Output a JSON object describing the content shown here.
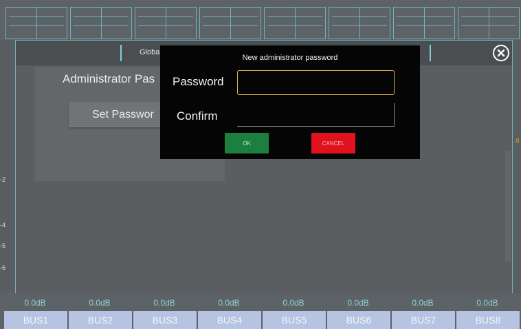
{
  "bus_strip": {
    "levels": [
      "0.0dB",
      "0.0dB",
      "0.0dB",
      "0.0dB",
      "0.0dB",
      "0.0dB",
      "0.0dB",
      "0.0dB"
    ],
    "buses": [
      "BUS1",
      "BUS2",
      "BUS3",
      "BUS4",
      "BUS5",
      "BUS6",
      "BUS7",
      "BUS8"
    ]
  },
  "scale_marks": [
    "-2",
    "-4",
    "-5",
    "-6"
  ],
  "right_marker": "8",
  "settings_panel": {
    "tab_label": "Globa",
    "admin_title": "Administrator Pas",
    "set_password_label": "Set Passwor"
  },
  "dialog": {
    "title": "New administrator password",
    "password_label": "Password",
    "password_value": "",
    "confirm_label": "Confirm",
    "confirm_value": "",
    "ok_label": "OK",
    "cancel_label": "CANCEL"
  },
  "colors": {
    "accent": "#6fb3bd",
    "ok": "#1b7f3f",
    "cancel": "#e0121e",
    "focus_border": "#e0b24c"
  }
}
